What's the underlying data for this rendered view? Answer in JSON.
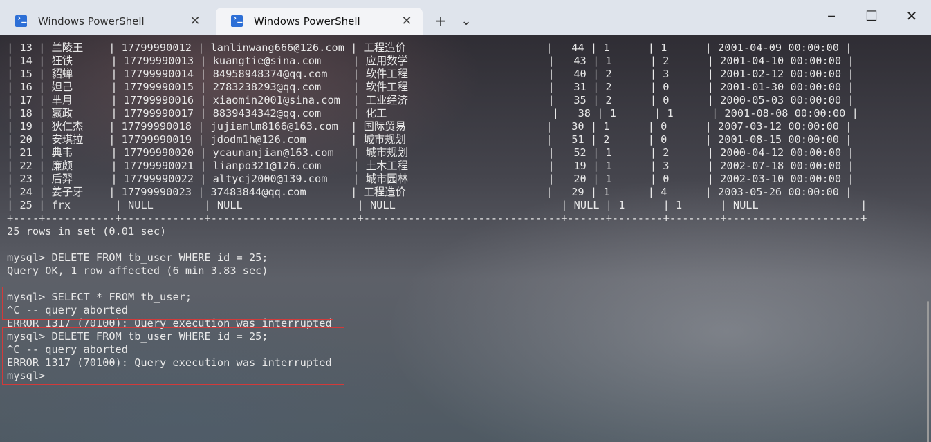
{
  "tabs": [
    {
      "title": "Windows PowerShell",
      "active": false
    },
    {
      "title": "Windows PowerShell",
      "active": true
    }
  ],
  "tab_close_symbol": "✕",
  "new_tab_symbol": "+",
  "dropdown_symbol": "⌄",
  "window_controls": {
    "minimize": "─",
    "maximize": "☐",
    "close": "✕"
  },
  "icons": [
    "powershell-icon",
    "close-icon",
    "plus-icon",
    "chevron-down-icon",
    "minimize-icon",
    "maximize-icon",
    "close-icon"
  ],
  "colors": {
    "highlight_box": "#d23a3a",
    "tabbar": "#dfe4ec",
    "terminal_text": "#e8e8e8"
  },
  "terminal": {
    "lines": [
      "| 13 | 兰陵王    | 17799990012 | lanlinwang666@126.com | 工程造价                      |   44 | 1      | 1      | 2001-04-09 00:00:00 |",
      "| 14 | 狂铁      | 17799990013 | kuangtie@sina.com     | 应用数学                      |   43 | 1      | 2      | 2001-04-10 00:00:00 |",
      "| 15 | 貂蝉      | 17799990014 | 84958948374@qq.com    | 软件工程                      |   40 | 2      | 3      | 2001-02-12 00:00:00 |",
      "| 16 | 妲己      | 17799990015 | 2783238293@qq.com     | 软件工程                      |   31 | 2      | 0      | 2001-01-30 00:00:00 |",
      "| 17 | 芈月      | 17799990016 | xiaomin2001@sina.com  | 工业经济                      |   35 | 2      | 0      | 2000-05-03 00:00:00 |",
      "| 18 | 嬴政      | 17799990017 | 8839434342@qq.com     | 化工                          |   38 | 1      | 1      | 2001-08-08 00:00:00 |",
      "| 19 | 狄仁杰    | 17799990018 | jujiamlm8166@163.com  | 国际贸易                      |   30 | 1      | 0      | 2007-03-12 00:00:00 |",
      "| 20 | 安琪拉    | 17799990019 | jdodm1h@126.com       | 城市规划                      |   51 | 2      | 0      | 2001-08-15 00:00:00 |",
      "| 21 | 典韦      | 17799990020 | ycaunanjian@163.com   | 城市规划                      |   52 | 1      | 2      | 2000-04-12 00:00:00 |",
      "| 22 | 廉颇      | 17799990021 | lianpo321@126.com     | 土木工程                      |   19 | 1      | 3      | 2002-07-18 00:00:00 |",
      "| 23 | 后羿      | 17799990022 | altycj2000@139.com    | 城市园林                      |   20 | 1      | 0      | 2002-03-10 00:00:00 |",
      "| 24 | 姜子牙    | 17799990023 | 37483844@qq.com       | 工程造价                      |   29 | 1      | 4      | 2003-05-26 00:00:00 |",
      "| 25 | frx       | NULL        | NULL                  | NULL                          | NULL | 1      | 1      | NULL                |",
      "+----+-----------+-------------+-----------------------+-------------------------------+------+--------+--------+---------------------+",
      "25 rows in set (0.01 sec)",
      "",
      "mysql> DELETE FROM tb_user WHERE id = 25;",
      "Query OK, 1 row affected (6 min 3.83 sec)",
      "",
      "mysql> SELECT * FROM tb_user;",
      "^C -- query aborted",
      "ERROR 1317 (70100): Query execution was interrupted",
      "mysql> DELETE FROM tb_user WHERE id = 25;",
      "^C -- query aborted",
      "ERROR 1317 (70100): Query execution was interrupted",
      "mysql> "
    ]
  }
}
